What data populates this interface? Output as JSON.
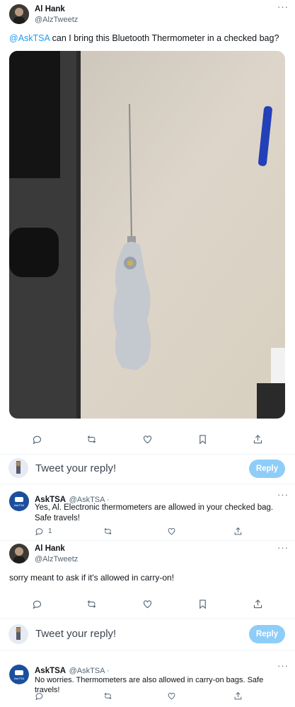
{
  "tweet": {
    "author_name": "Al Hank",
    "author_handle": "@AlzTweetz",
    "mention": "@AskTSA",
    "text": " can I bring this Bluetooth Thermometer in a checked bag?",
    "image_alt": "Bluetooth thermometer with probe on table",
    "more_icon": "more-icon",
    "actions": [
      "reply-icon",
      "retweet-icon",
      "like-icon",
      "bookmark-icon",
      "share-icon"
    ]
  },
  "reply_box_1": {
    "placeholder": "Tweet your reply!",
    "button": "Reply"
  },
  "reply_1": {
    "author_name": "AskTSA",
    "author_handle": "@AskTSA ·",
    "avatar_label": "AskTSA",
    "text": "Yes, Al. Electronic thermometers are allowed in your checked bag. Safe travels!",
    "reply_count": "1"
  },
  "tweet_2": {
    "author_name": "Al Hank",
    "author_handle": "@AlzTweetz",
    "text": "sorry meant to ask if it's allowed in carry-on!"
  },
  "reply_box_2": {
    "placeholder": "Tweet your reply!",
    "button": "Reply"
  },
  "reply_2": {
    "author_name": "AskTSA",
    "author_handle": "@AskTSA ·",
    "avatar_label": "AskTSA",
    "text": "No worries. Thermometers are also allowed in carry-on bags. Safe travels!"
  },
  "colors": {
    "accent": "#1d9bf0",
    "reply_button": "#8ecdf8",
    "tsa_blue": "#1b4f9c"
  }
}
